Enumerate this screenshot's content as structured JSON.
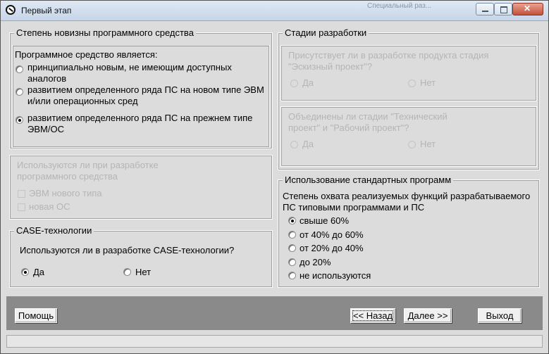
{
  "window": {
    "title": "Первый этап",
    "background_hint": "Специальный раз..."
  },
  "novelty": {
    "legend": "Степень новизны программного средства",
    "question": "Программное средство является:",
    "options": [
      "принципиально новым, не имеющим доступных аналогов",
      "развитием определенного ряда ПС на новом типе ЭВМ и/или операционных сред",
      "развитием определенного ряда ПС на прежнем типе ЭВМ/ОС"
    ],
    "selected_index": 2
  },
  "new_platform": {
    "question": "Используются ли при разработке программного средства",
    "options": [
      "ЭВМ нового типа",
      "новая ОС"
    ]
  },
  "case": {
    "legend": "CASE-технологии",
    "question": "Используются ли в разработке CASE-технологии?",
    "yes": "Да",
    "no": "Нет",
    "selected": "yes"
  },
  "stages": {
    "legend": "Стадии разработки",
    "q1": "Присутствует ли в разработке продукта стадия \"Эскизный проект\"?",
    "q2": "Объединены ли стадии \"Технический проект\" и \"Рабочий проект\"?",
    "yes": "Да",
    "no": "Нет"
  },
  "std": {
    "legend": "Использование стандартных программ",
    "question": "Степень охвата реализуемых функций разрабатываемого ПС типовыми программами и ПС",
    "options": [
      "свыше 60%",
      "от 40% до 60%",
      "от 20% до 40%",
      "до 20%",
      "не используются"
    ],
    "selected_index": 0
  },
  "buttons": {
    "help": "Помощь",
    "back": "<< Назад",
    "next": "Далее >>",
    "exit": "Выход"
  }
}
